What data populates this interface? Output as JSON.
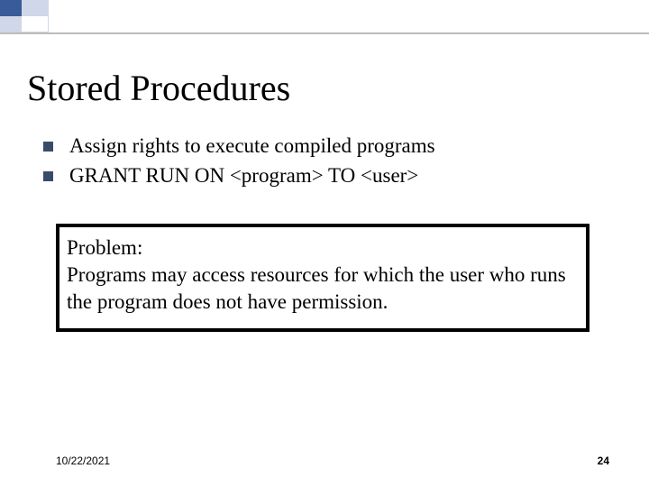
{
  "title": "Stored Procedures",
  "bullets": [
    "Assign rights to execute compiled programs",
    "GRANT RUN ON <program> TO <user>"
  ],
  "problem": {
    "label": "Problem:",
    "body": "Programs may access resources for which the user who runs the program does not have permission."
  },
  "footer": {
    "date": "10/22/2021",
    "page": "24"
  }
}
